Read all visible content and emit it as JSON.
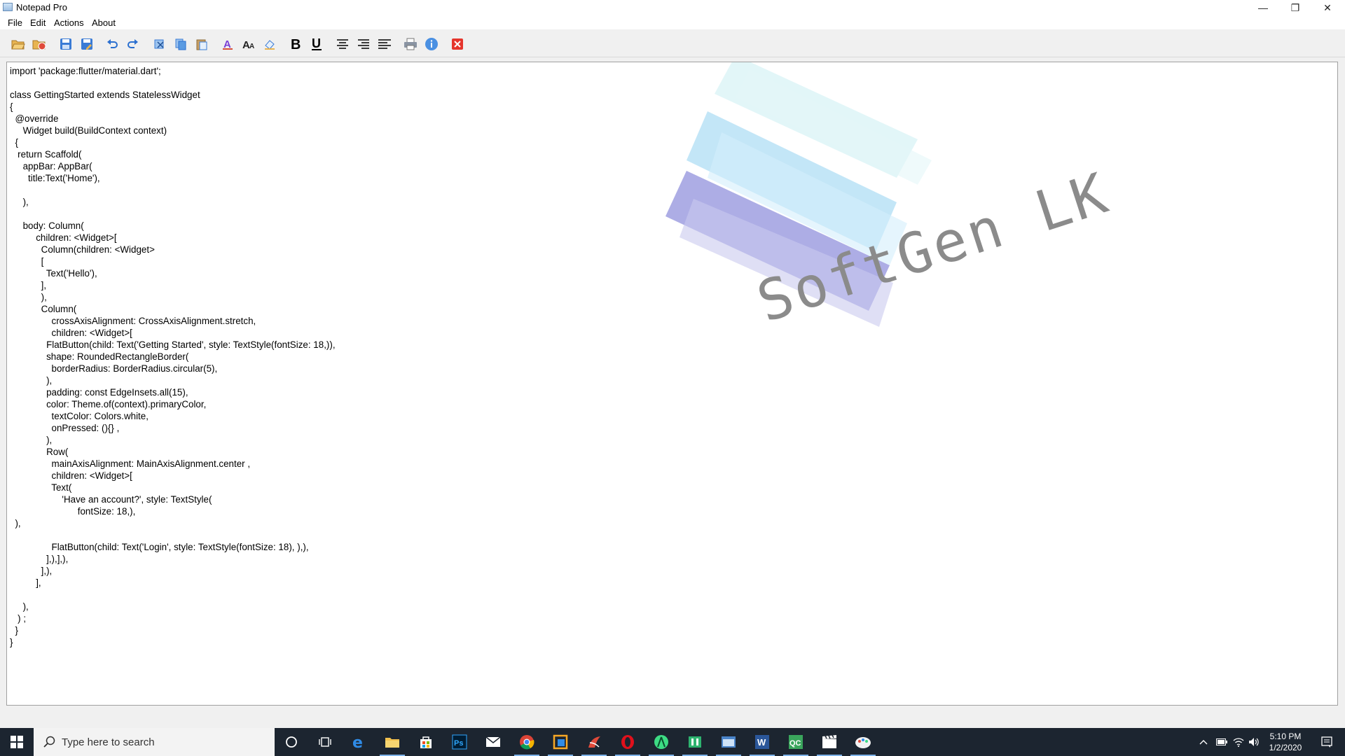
{
  "window": {
    "title": "Notepad Pro"
  },
  "window_controls": {
    "minimize": "—",
    "maximize": "❐",
    "close": "✕"
  },
  "menu": [
    "File",
    "Edit",
    "Actions",
    "About"
  ],
  "toolbar": {
    "buttons": [
      "open-folder",
      "open-recent",
      "save",
      "save-as",
      "undo",
      "redo",
      "cut",
      "copy",
      "paste",
      "font-color",
      "font-size",
      "highlight",
      "bold",
      "underline",
      "align-center",
      "align-right",
      "align-left",
      "print",
      "info",
      "exit"
    ]
  },
  "editor": {
    "content": "import 'package:flutter/material.dart';\n\nclass GettingStarted extends StatelessWidget\n{\n  @override\n     Widget build(BuildContext context)\n  {\n   return Scaffold(\n     appBar: AppBar(\n       title:Text('Home'),\n\n     ),\n\n     body: Column(\n          children: <Widget>[\n            Column(children: <Widget>\n            [\n              Text('Hello'),\n            ],\n            ),\n            Column(\n                crossAxisAlignment: CrossAxisAlignment.stretch,\n                children: <Widget>[\n              FlatButton(child: Text('Getting Started', style: TextStyle(fontSize: 18,)),\n              shape: RoundedRectangleBorder(\n                borderRadius: BorderRadius.circular(5),\n              ),\n              padding: const EdgeInsets.all(15),\n              color: Theme.of(context).primaryColor,\n                textColor: Colors.white,\n                onPressed: (){} ,\n              ),\n              Row(\n                mainAxisAlignment: MainAxisAlignment.center ,\n                children: <Widget>[\n                Text(\n                    'Have an account?', style: TextStyle(\n                          fontSize: 18,),\n  ),\n\n                FlatButton(child: Text('Login', style: TextStyle(fontSize: 18), ),),\n              ],),],),\n            ],),\n          ],\n\n     ),\n   ) ;\n  }\n}"
  },
  "watermark": {
    "text": "SoftGen LK"
  },
  "taskbar": {
    "search_placeholder": "Type here to search",
    "apps": [
      "cortana",
      "task-view",
      "edge",
      "file-explorer",
      "store",
      "photoshop",
      "mail",
      "chrome",
      "app-orange",
      "app-red",
      "opera",
      "android-studio",
      "app-green",
      "app-window",
      "word",
      "qc",
      "video",
      "notepad-pro"
    ],
    "clock": {
      "time": "5:10 PM",
      "date": "1/2/2020"
    }
  },
  "colors": {
    "taskbar": "#1c2530",
    "accent": "#7eb4ea",
    "close_icon": "#e5352c"
  }
}
